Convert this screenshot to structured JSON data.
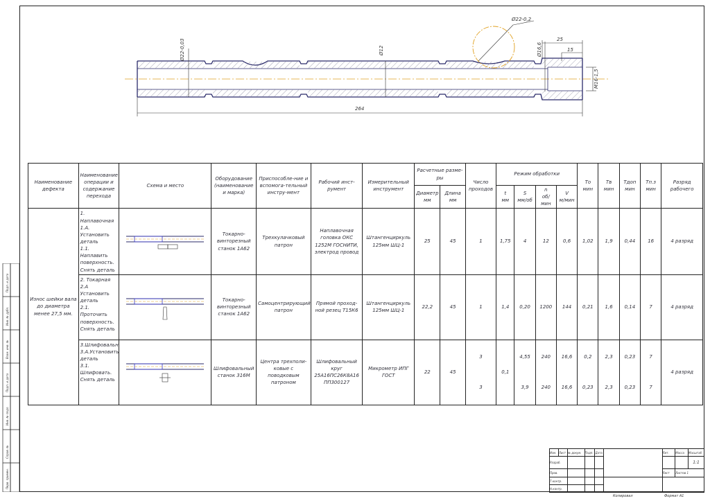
{
  "drawing": {
    "dim_d22_left": "Ø22-0,03",
    "dim_d12": "Ø12",
    "dim_d22_circle": "Ø22-0,2",
    "dim_25": "25",
    "dim_15": "15",
    "dim_d16": "Ø16,6",
    "dim_m16": "M16-1,5",
    "dim_264": "264"
  },
  "table": {
    "headers": {
      "defect": "Наименование дефекта",
      "ops": "Наименование операции и содержание перехода",
      "scheme": "Схема и место",
      "equipment": "Оборудование (наименование и марка)",
      "fixtures": "Приспособле-ние и вспомога-тельный инстру-мент",
      "working_tool": "Рабочий инст-румент",
      "measuring_tool": "Измерительный инструмент",
      "calc_sizes": "Расчетные разме-ры",
      "diameter": "Диаметр мм",
      "length": "Длина мм",
      "passes": "Число проходов",
      "mode": "Режим обработки",
      "t": "t",
      "t_unit": "мм",
      "s": "S",
      "s_unit": "мм/об",
      "n": "n",
      "n_unit": "об/мин",
      "v": "V",
      "v_unit": "м/мин",
      "to": "То",
      "to_unit": "мин",
      "tv": "Тв",
      "tv_unit": "мин",
      "top": "Тдоп",
      "top_unit": "мин",
      "tpz": "Тп.з",
      "tpz_unit": "мин",
      "grade": "Разряд рабочего"
    },
    "defect": "Износ шейки вала до диаметра менее 27,5 мм.",
    "rows": [
      {
        "ops": "1. Наплавочная\n1.А. Установить деталь\n1.1. Наплавить поверхность.\nСнять деталь",
        "equipment": "Токарно-винторезный станок 1А62",
        "fixtures": "Трехкулачковый патрон",
        "working_tool": "Наплавочная головка ОКС 1252М ГОСНИТИ, электрод провод",
        "measuring_tool": "Штангенциркуль 125мм ШЦ-1",
        "diameter": "25",
        "length": "45",
        "passes": "1",
        "t": "1,75",
        "s": "4",
        "n": "12",
        "v": "0,6",
        "to": "1,02",
        "tv": "1,9",
        "top": "0,44",
        "tpz": "16",
        "grade": "4 разряд"
      },
      {
        "ops": "2. Токарная\n2.А Установить деталь\n2.1. Проточить поверхность.\nСнять деталь",
        "equipment": "Токарно-винторезный станок 1А62",
        "fixtures": "Самоцентрирующий патрон",
        "working_tool": "Прямой проход-ной резец Т15К6",
        "measuring_tool": "Штангенциркуль 125мм ШЦ-1",
        "diameter": "22,2",
        "length": "45",
        "passes": "1",
        "t": "1,4",
        "s": "0,20",
        "n": "1200",
        "v": "144",
        "to": "0,21",
        "tv": "1,6",
        "top": "0,14",
        "tpz": "7",
        "grade": "4 разряд"
      },
      {
        "ops": "3.Шлифовальная\n3.А.Установить деталь\n3.1. Шлифовать.\nСнять деталь",
        "equipment": "Шлифовальный станок 316М",
        "fixtures": "Центра трехполи-ковые с поводковым патроном",
        "working_tool": "Шлифовальный круг 25А16ПС26К8А16 ПП300127",
        "measuring_tool": "Микрометр ИПГ ГОСТ",
        "diameter": "22",
        "length": "45",
        "passes_a": "3",
        "passes_b": "3",
        "t": "0,1",
        "s_a": "4,55",
        "s_b": "3,9",
        "n_a": "240",
        "n_b": "240",
        "v_a": "16,6",
        "v_b": "16,6",
        "to_a": "0,2",
        "to_b": "0,23",
        "tv_a": "2,3",
        "tv_b": "2,3",
        "top_a": "0,23",
        "top_b": "0,23",
        "tpz_a": "7",
        "tpz_b": "7",
        "grade": "4 разряд"
      }
    ]
  },
  "stamp": {
    "lit": "Лит.",
    "mass": "Масса",
    "scale": "Масштаб",
    "scale_val": "1:1",
    "sheet": "Лист",
    "sheets": "Листов",
    "sheets_val": "1",
    "izm": "Изм.",
    "list": "Лист",
    "doc": "№ докум.",
    "sign": "Подп.",
    "date": "Дата",
    "razrab": "Разраб.",
    "prov": "Пров.",
    "tkontr": "Т.контр.",
    "nkontr": "Н.контр.",
    "utv": "Утв."
  },
  "footer": {
    "copied": "Копировал",
    "format": "Формат A1"
  },
  "left_strip": [
    "Подп. и дата",
    "Инв. № дубл.",
    "Взам. инв. №",
    "Подп. и дата",
    "Инв. № подл.",
    "Справ. №",
    "Перв. примен."
  ]
}
